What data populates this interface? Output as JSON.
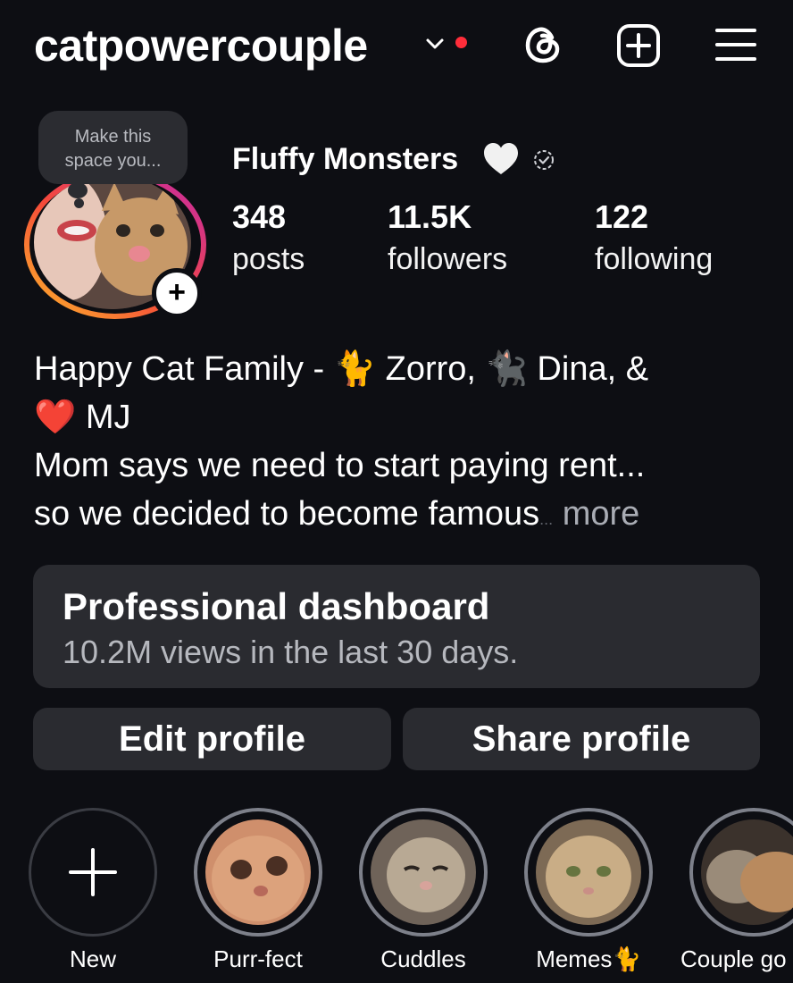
{
  "header": {
    "username": "catpowercouple",
    "icons": [
      "chevron-down-icon",
      "notification-dot",
      "threads-icon",
      "new-post-icon",
      "menu-icon"
    ]
  },
  "note": {
    "text_line1": "Make this",
    "text_line2": "space you..."
  },
  "profile": {
    "display_name": "Fluffy Monsters",
    "name_emoji": "white-heart",
    "stats": [
      {
        "value": "348",
        "label": "posts"
      },
      {
        "value": "11.5K",
        "label": "followers"
      },
      {
        "value": "122",
        "label": "following"
      }
    ]
  },
  "bio": {
    "line1_a": "Happy Cat Family - ",
    "line1_emoji1": "🐈",
    "line1_b": " Zorro, ",
    "line1_emoji2": "🐈‍⬛",
    "line1_c": " Dina, &",
    "line2_emoji": "❤️",
    "line2_text": " MJ",
    "line3": "Mom says we need to start paying rent...",
    "line4": "so we decided to become famous",
    "ellipsis": "...",
    "more": "more"
  },
  "dashboard": {
    "title": "Professional dashboard",
    "subtitle": "10.2M views in the last 30 days."
  },
  "buttons": {
    "edit": "Edit profile",
    "share": "Share profile"
  },
  "highlights": [
    {
      "label": "New"
    },
    {
      "label": "Purr-fect"
    },
    {
      "label": "Cuddles"
    },
    {
      "label": "Memes",
      "emoji": "🐈"
    },
    {
      "label": "Couple go"
    }
  ],
  "colors": {
    "background": "#0d0e13",
    "card": "#2a2b30",
    "notification": "#ff2d3a",
    "muted_text": "#b6b8be"
  }
}
